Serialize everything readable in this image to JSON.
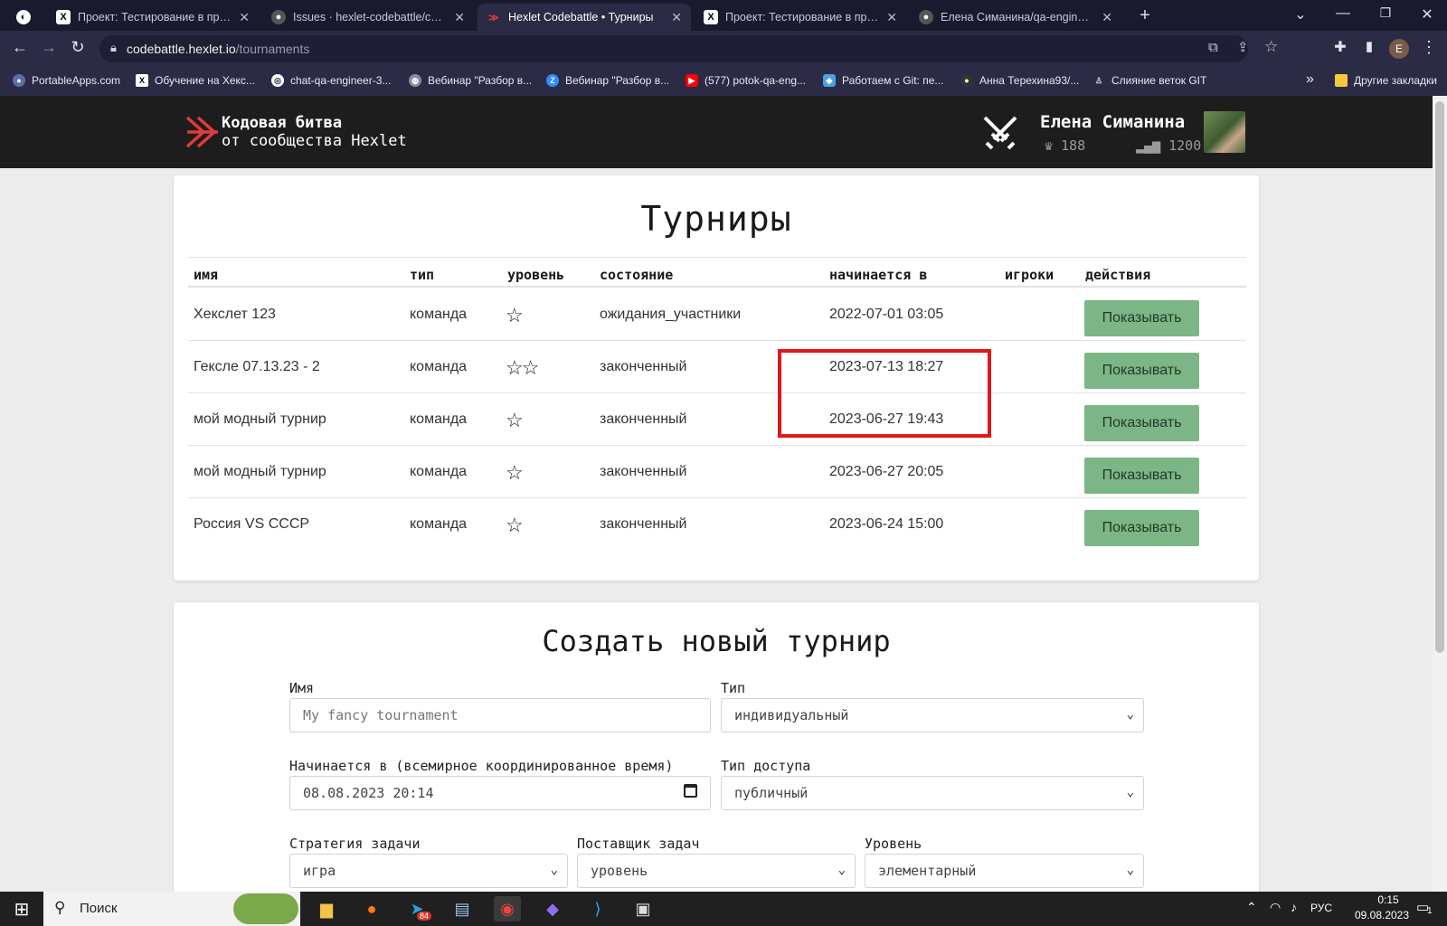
{
  "browser": {
    "tabs": [
      {
        "label": "",
        "icon": "hexlet-icon"
      },
      {
        "label": "Проект: Тестирование в продак",
        "icon": "hexlet-icon"
      },
      {
        "label": "Issues · hexlet-codebattle/codeb",
        "icon": "github-icon"
      },
      {
        "label": "Hexlet Codebattle • Турниры",
        "icon": "codebattle-icon",
        "active": true
      },
      {
        "label": "Проект: Тестирование в продак",
        "icon": "hexlet-icon"
      },
      {
        "label": "Елена Симанина/qa-engineer-p",
        "icon": "github-icon"
      }
    ],
    "new_tab": "+",
    "url_host": "codebattle.hexlet.io",
    "url_path": "/tournaments",
    "profile_initial": "E",
    "bookmarks": [
      "PortableApps.com",
      "Обучение на Хекс...",
      "chat-qa-engineer-3...",
      "Вебинар \"Разбор в...",
      "Вебинар \"Разбор в...",
      "(577) potok-qa-eng...",
      "Работаем с Git: пе...",
      "Анна Терехина93/...",
      "Слияние веток GIT"
    ],
    "bookmarks_more": "»",
    "other_bookmarks": "Другие закладки"
  },
  "site": {
    "brand_line1": "Кодовая битва",
    "brand_line2": "от сообщества Hexlet",
    "user_name": "Елена Симанина",
    "trophies": "188",
    "rating": "1200"
  },
  "tournaments": {
    "title": "Турниры",
    "columns": [
      "имя",
      "тип",
      "уровень",
      "состояние",
      "начинается в",
      "игроки",
      "действия"
    ],
    "rows": [
      {
        "name": "Хекслет 123",
        "type": "команда",
        "level": "☆",
        "state": "ожидания_участники",
        "starts_at": "2022-07-01 03:05",
        "players": "",
        "action": "Показывать"
      },
      {
        "name": "Гексле 07.13.23 - 2",
        "type": "команда",
        "level": "☆☆",
        "state": "законченный",
        "starts_at": "2023-07-13 18:27",
        "players": "",
        "action": "Показывать"
      },
      {
        "name": "мой модный турнир",
        "type": "команда",
        "level": "☆",
        "state": "законченный",
        "starts_at": "2023-06-27 19:43",
        "players": "",
        "action": "Показывать"
      },
      {
        "name": "мой модный турнир",
        "type": "команда",
        "level": "☆",
        "state": "законченный",
        "starts_at": "2023-06-27 20:05",
        "players": "",
        "action": "Показывать"
      },
      {
        "name": "Россия VS СССР",
        "type": "команда",
        "level": "☆",
        "state": "законченный",
        "starts_at": "2023-06-24 15:00",
        "players": "",
        "action": "Показывать"
      }
    ],
    "highlight_color": "#e0171c",
    "button_color": "#7cb586"
  },
  "create": {
    "title": "Создать новый турнир",
    "name_label": "Имя",
    "name_placeholder": "My fancy tournament",
    "type_label": "Тип",
    "type_value": "индивидуальный",
    "starts_label": "Начинается в (всемирное координированное время)",
    "starts_value": "08.08.2023 20:14",
    "access_label": "Тип доступа",
    "access_value": "публичный",
    "strategy_label": "Стратегия задачи",
    "strategy_value": "игра",
    "provider_label": "Поставщик задач",
    "provider_value": "уровень",
    "level_label": "Уровень",
    "level_value": "элементарный"
  },
  "taskbar": {
    "search": "Поиск",
    "lang": "РУС",
    "time": "0:15",
    "date": "09.08.2023",
    "telegram_badge": "84",
    "notifications": "1"
  }
}
